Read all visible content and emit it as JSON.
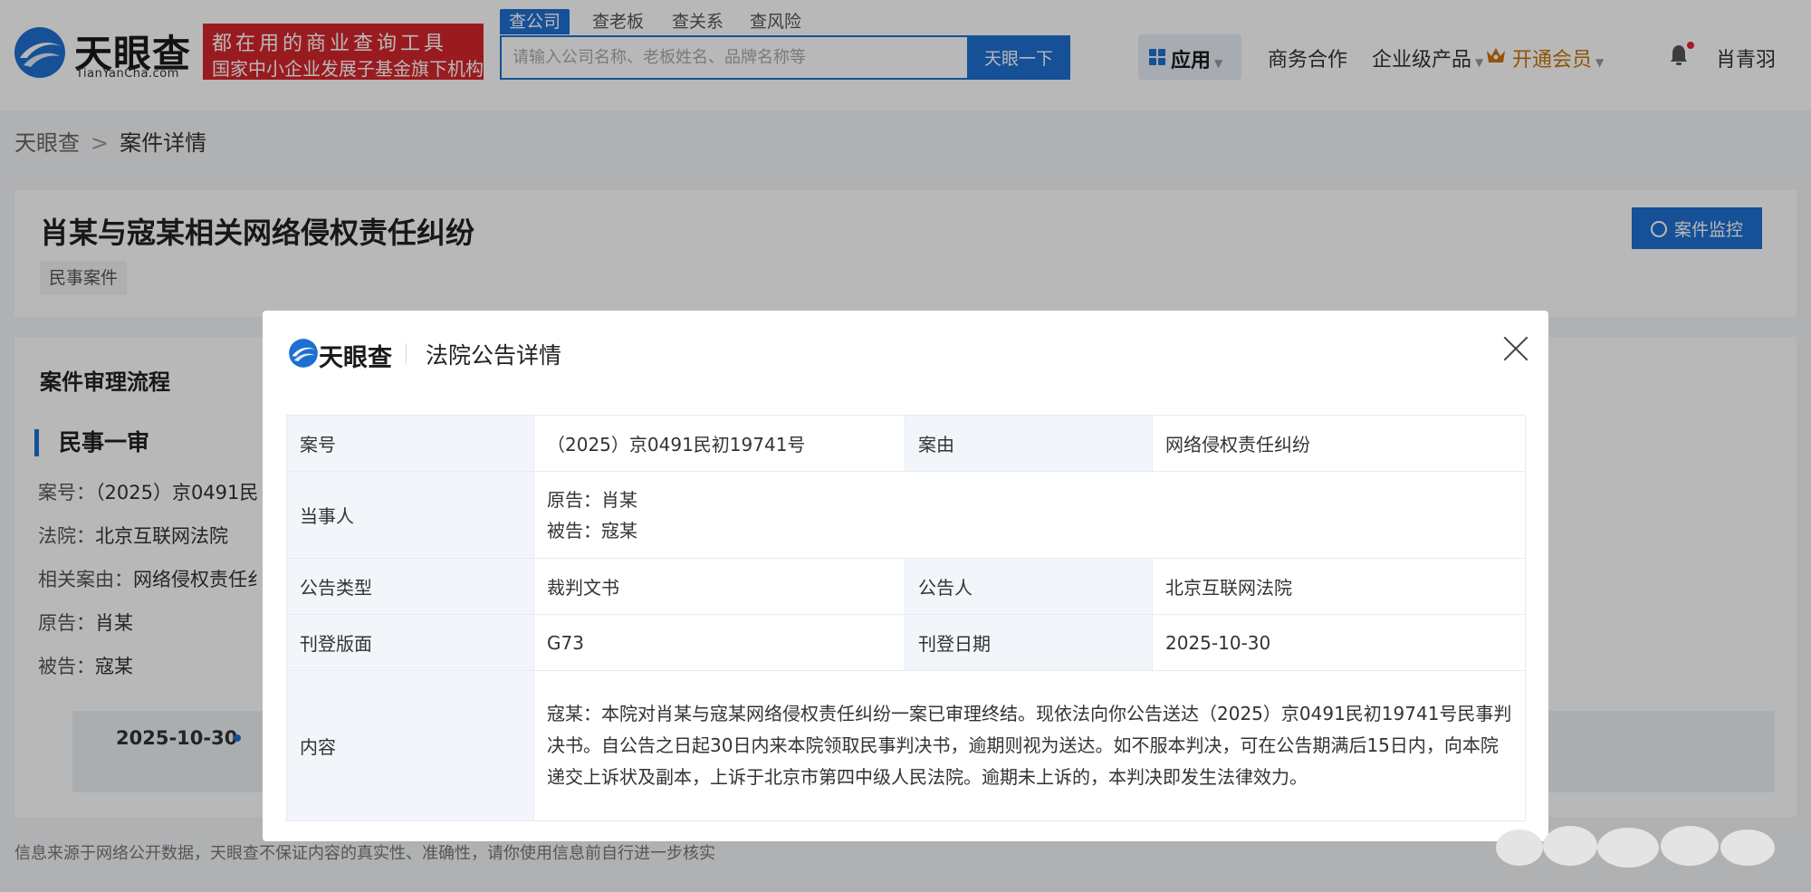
{
  "header": {
    "logo_title": "天眼查",
    "logo_sub": "TianYanCha.com",
    "slogan_line1": "都在用的商业查询工具",
    "slogan_line2": "国家中小企业发展子基金旗下机构",
    "search_tabs": [
      "查公司",
      "查老板",
      "查关系",
      "查风险"
    ],
    "search_placeholder": "请输入公司名称、老板姓名、品牌名称等",
    "search_button": "天眼一下",
    "app_label": "应用",
    "nav": {
      "business": "商务合作",
      "enterprise": "企业级产品",
      "vip": "开通会员",
      "user": "肖青羽"
    },
    "colors": {
      "brand": "#1f6fd1",
      "slogan_bg": "#d6262b",
      "vip": "#c9730a"
    }
  },
  "breadcrumb": {
    "home": "天眼查",
    "current": "案件详情"
  },
  "case": {
    "title": "肖某与寇某相关网络侵权责任纠纷",
    "tag": "民事案件",
    "monitor_button": "案件监控"
  },
  "process": {
    "title": "案件审理流程",
    "stage": "民事一审",
    "lines": [
      {
        "label": "案号：",
        "value": "（2025）京0491民"
      },
      {
        "label": "法院：",
        "value": "北京互联网法院"
      },
      {
        "label": "相关案由：",
        "value": "网络侵权责任纟"
      },
      {
        "label": "原告：",
        "value": "肖某"
      },
      {
        "label": "被告：",
        "value": "寇某"
      }
    ],
    "timeline_date": "2025-10-30"
  },
  "footer_note": "信息来源于网络公开数据，天眼查不保证内容的真实性、准确性，请你使用信息前自行进一步核实",
  "modal": {
    "logo_text": "天眼查",
    "title": "法院公告详情",
    "case_no_label": "案号",
    "case_no": "（2025）京0491民初19741号",
    "cause_label": "案由",
    "cause": "网络侵权责任纠纷",
    "parties_label": "当事人",
    "plaintiff": "原告：肖某",
    "defendant": "被告：寇某",
    "type_label": "公告类型",
    "type": "裁判文书",
    "announcer_label": "公告人",
    "announcer": "北京互联网法院",
    "page_label": "刊登版面",
    "page": "G73",
    "date_label": "刊登日期",
    "date": "2025-10-30",
    "content_label": "内容",
    "content": "寇某：本院对肖某与寇某网络侵权责任纠纷一案已审理终结。现依法向你公告送达（2025）京0491民初19741号民事判决书。自公告之日起30日内来本院领取民事判决书，逾期则视为送达。如不服本判决，可在公告期满后15日内，向本院递交上诉状及副本，上诉于北京市第四中级人民法院。逾期未上诉的，本判决即发生法律效力。"
  }
}
